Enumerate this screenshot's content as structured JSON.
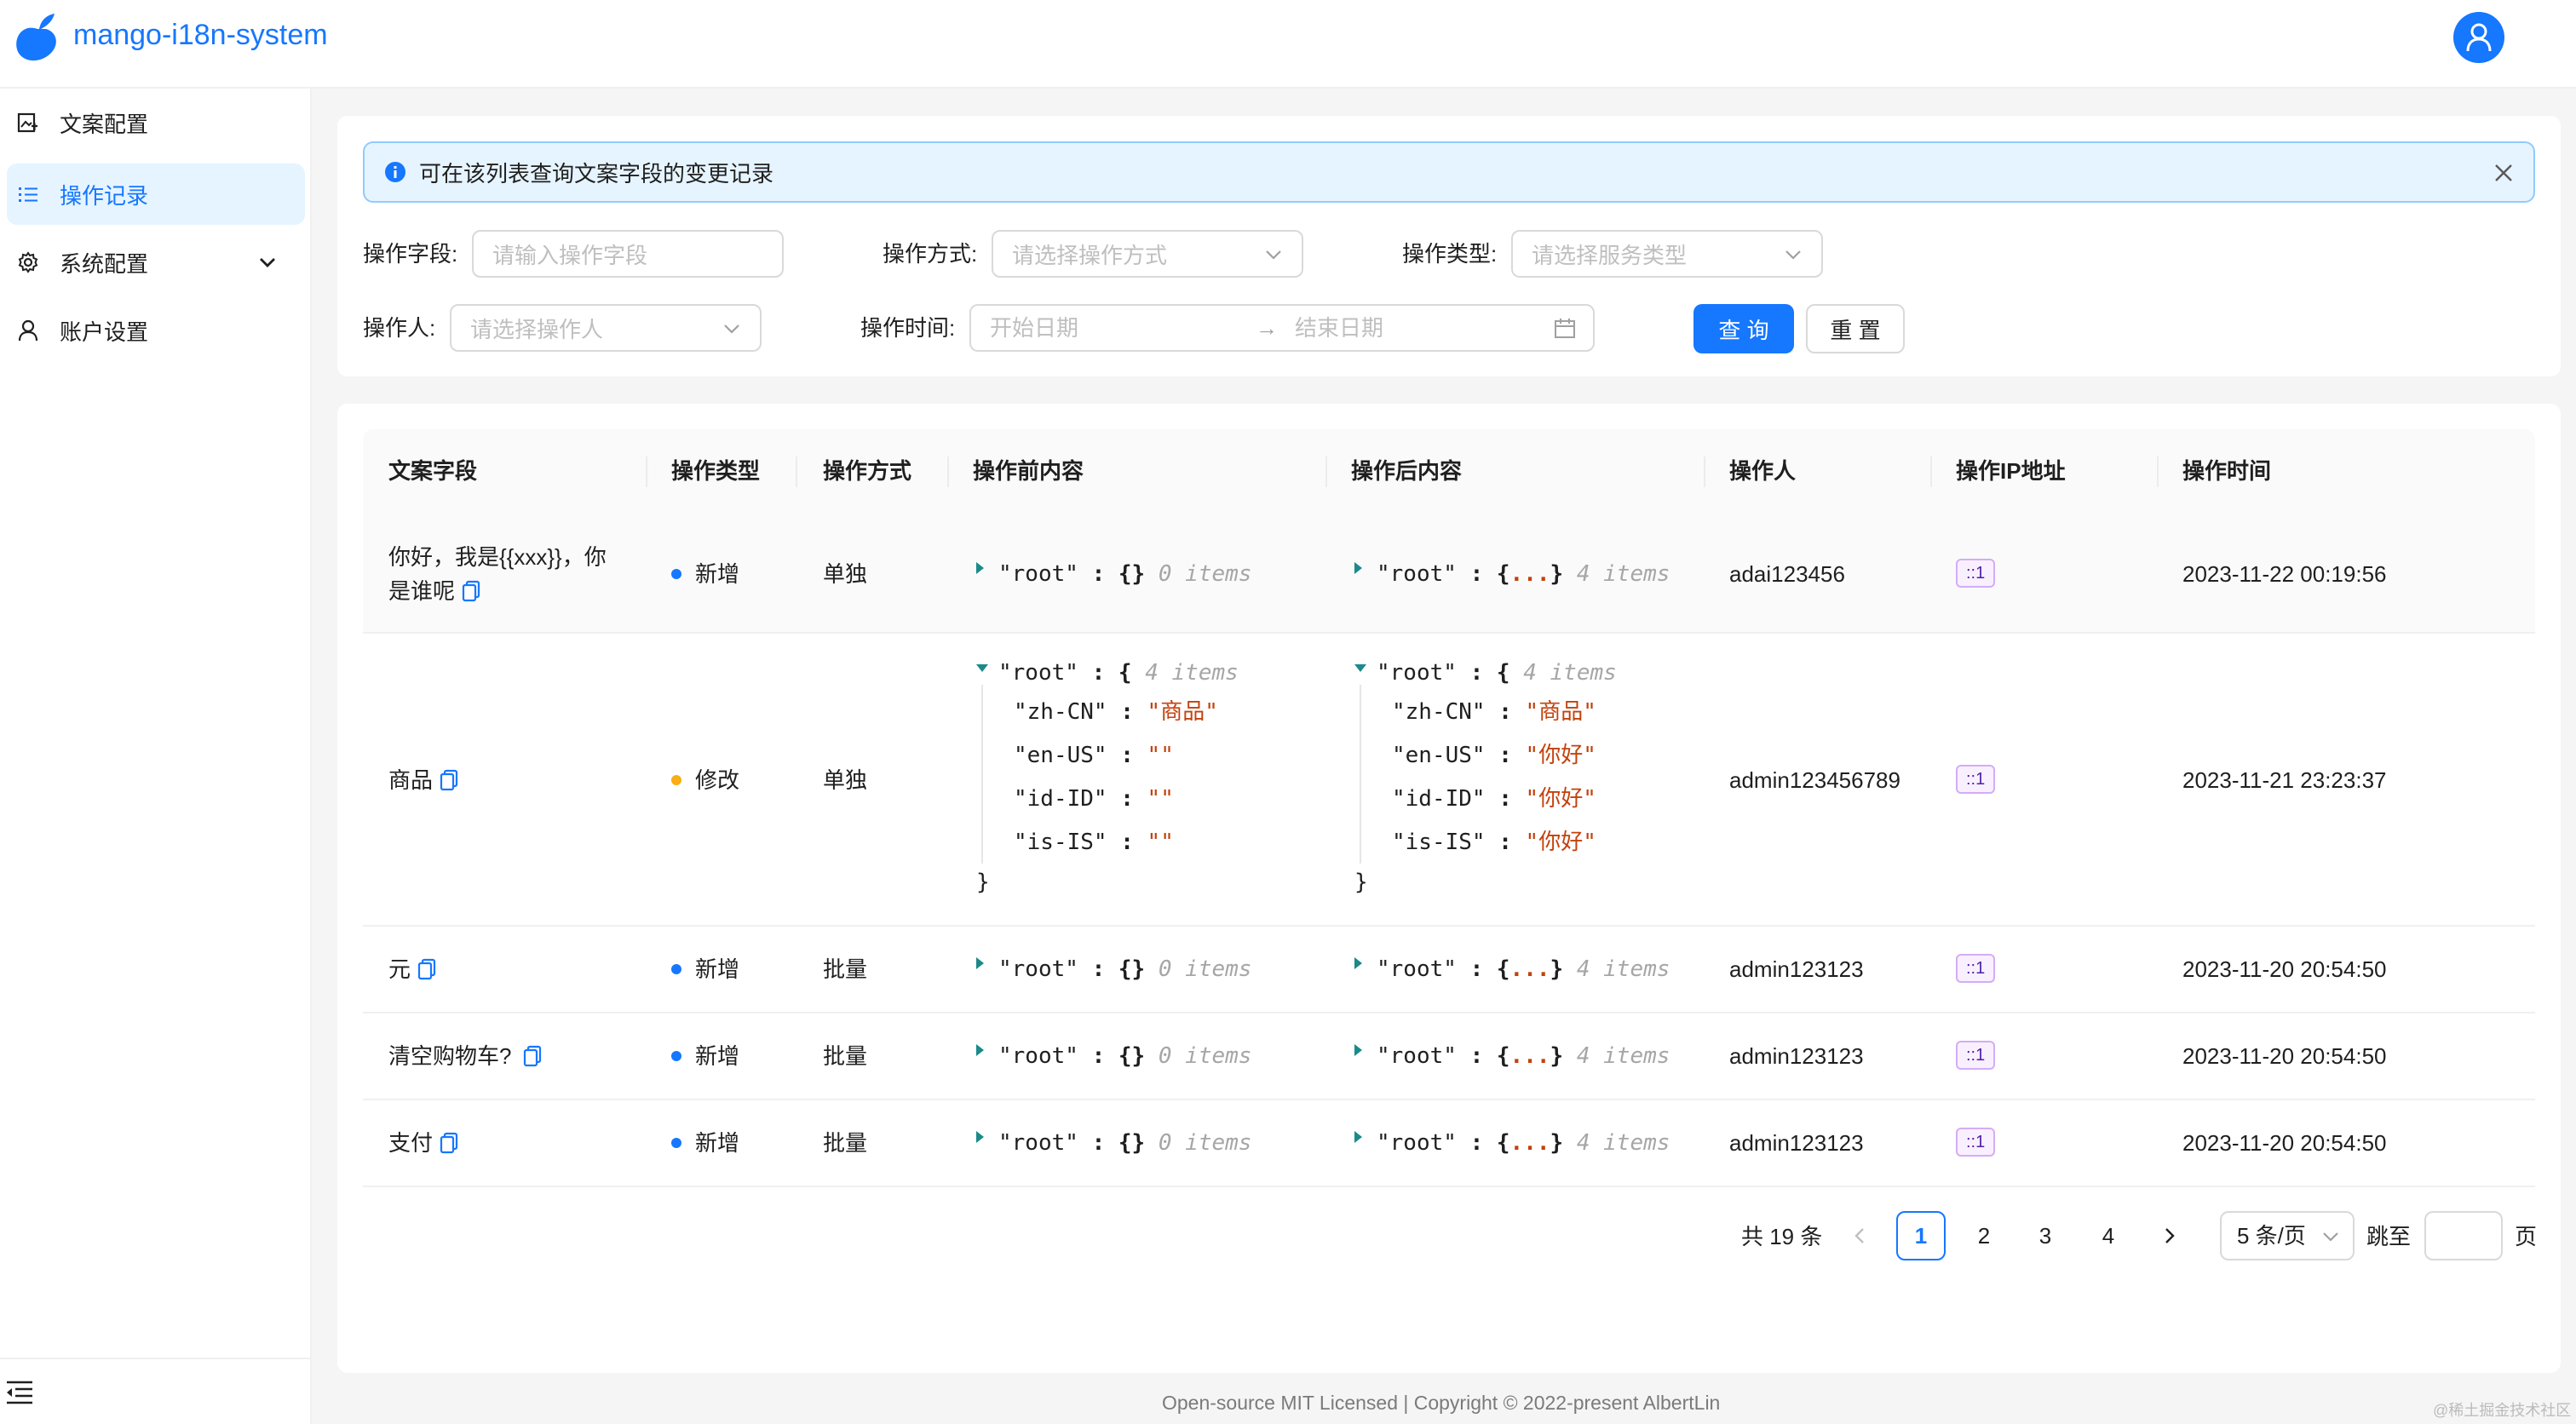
{
  "app": {
    "title": "mango-i18n-system"
  },
  "sidebar": {
    "items": [
      {
        "label": "文案配置",
        "icon": "image-doc-icon"
      },
      {
        "label": "操作记录",
        "icon": "list-icon",
        "active": true
      },
      {
        "label": "系统配置",
        "icon": "gear-icon",
        "has_submenu": true
      },
      {
        "label": "账户设置",
        "icon": "user-icon"
      }
    ]
  },
  "alert": {
    "text": "可在该列表查询文案字段的变更记录"
  },
  "filters": {
    "field": {
      "label": "操作字段:",
      "placeholder": "请输入操作字段"
    },
    "method": {
      "label": "操作方式:",
      "placeholder": "请选择操作方式"
    },
    "type": {
      "label": "操作类型:",
      "placeholder": "请选择服务类型"
    },
    "operator": {
      "label": "操作人:",
      "placeholder": "请选择操作人"
    },
    "time": {
      "label": "操作时间:",
      "start_placeholder": "开始日期",
      "end_placeholder": "结束日期",
      "arrow": "→"
    },
    "query_button": "查 询",
    "reset_button": "重 置"
  },
  "table": {
    "columns": [
      "文案字段",
      "操作类型",
      "操作方式",
      "操作前内容",
      "操作后内容",
      "操作人",
      "操作IP地址",
      "操作时间"
    ],
    "rows": [
      {
        "field": "你好，我是{{xxx}}，你是谁呢",
        "field_line1": "你好，我是{{xxx}}，你",
        "field_line2": "是谁呢",
        "type": "新增",
        "type_color": "#1677ff",
        "method": "单独",
        "before": {
          "key": "\"root\"",
          "sep": ":",
          "brace": "{}",
          "count": "0 items"
        },
        "after": {
          "key": "\"root\"",
          "sep": ":",
          "open": "{",
          "dots": "...",
          "close": "}",
          "count": "4 items"
        },
        "operator": "adai123456",
        "ip": "::1",
        "time": "2023-11-22 00:19:56"
      },
      {
        "field": "商品",
        "type": "修改",
        "type_color": "#faad14",
        "method": "单独",
        "before": {
          "key": "\"root\"",
          "sep": ":",
          "open": "{",
          "close": "}",
          "count": "4 items",
          "entries": [
            {
              "key": "\"zh-CN\"",
              "value": "\"商品\""
            },
            {
              "key": "\"en-US\"",
              "value": "\"\""
            },
            {
              "key": "\"id-ID\"",
              "value": "\"\""
            },
            {
              "key": "\"is-IS\"",
              "value": "\"\""
            }
          ]
        },
        "after": {
          "key": "\"root\"",
          "sep": ":",
          "open": "{",
          "close": "}",
          "count": "4 items",
          "entries": [
            {
              "key": "\"zh-CN\"",
              "value": "\"商品\""
            },
            {
              "key": "\"en-US\"",
              "value": "\"你好\""
            },
            {
              "key": "\"id-ID\"",
              "value": "\"你好\""
            },
            {
              "key": "\"is-IS\"",
              "value": "\"你好\""
            }
          ]
        },
        "operator": "admin123456789",
        "ip": "::1",
        "time": "2023-11-21 23:23:37"
      },
      {
        "field": "元",
        "type": "新增",
        "type_color": "#1677ff",
        "method": "批量",
        "before": {
          "key": "\"root\"",
          "sep": ":",
          "brace": "{}",
          "count": "0 items"
        },
        "after": {
          "key": "\"root\"",
          "sep": ":",
          "open": "{",
          "dots": "...",
          "close": "}",
          "count": "4 items"
        },
        "operator": "admin123123",
        "ip": "::1",
        "time": "2023-11-20 20:54:50"
      },
      {
        "field": "清空购物车?",
        "type": "新增",
        "type_color": "#1677ff",
        "method": "批量",
        "before": {
          "key": "\"root\"",
          "sep": ":",
          "brace": "{}",
          "count": "0 items"
        },
        "after": {
          "key": "\"root\"",
          "sep": ":",
          "open": "{",
          "dots": "...",
          "close": "}",
          "count": "4 items"
        },
        "operator": "admin123123",
        "ip": "::1",
        "time": "2023-11-20 20:54:50"
      },
      {
        "field": "支付",
        "type": "新增",
        "type_color": "#1677ff",
        "method": "批量",
        "before": {
          "key": "\"root\"",
          "sep": ":",
          "brace": "{}",
          "count": "0 items"
        },
        "after": {
          "key": "\"root\"",
          "sep": ":",
          "open": "{",
          "dots": "...",
          "close": "}",
          "count": "4 items"
        },
        "operator": "admin123123",
        "ip": "::1",
        "time": "2023-11-20 20:54:50"
      }
    ]
  },
  "pagination": {
    "total": "共 19 条",
    "pages": [
      "1",
      "2",
      "3",
      "4"
    ],
    "current": "1",
    "page_size": "5 条/页",
    "jump_label": "跳至",
    "jump_suffix": "页"
  },
  "footer": {
    "text": "Open-source MIT Licensed | Copyright © 2022-present AlbertLin"
  },
  "watermark": {
    "text": "@稀土掘金技术社区"
  },
  "colors": {
    "primary": "#1677ff",
    "alert_bg": "#e6f4ff",
    "string": "#c4410c",
    "ip_tag": "#531dab",
    "modify_dot": "#faad14"
  }
}
